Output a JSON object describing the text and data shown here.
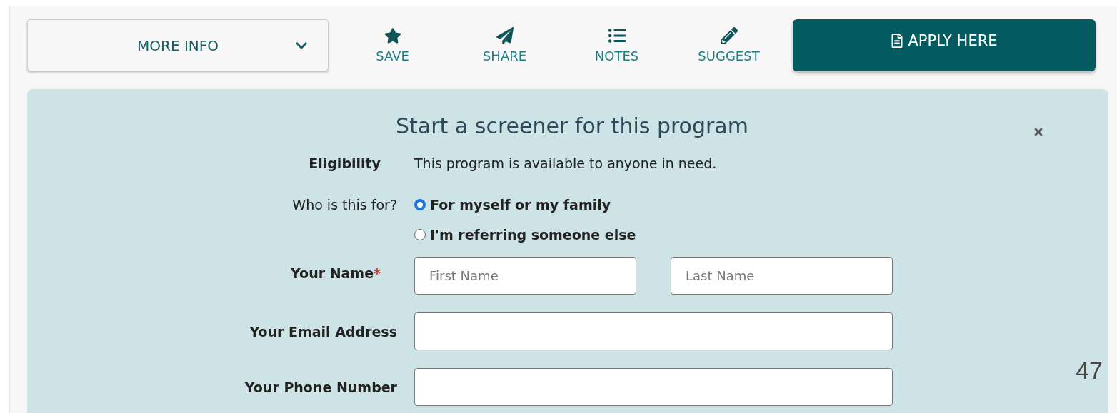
{
  "toolbar": {
    "more_info": {
      "label": "MORE INFO"
    },
    "actions": [
      {
        "kind": "save",
        "label": "SAVE"
      },
      {
        "kind": "share",
        "label": "SHARE"
      },
      {
        "kind": "notes",
        "label": "NOTES"
      },
      {
        "kind": "suggest",
        "label": "SUGGEST"
      }
    ],
    "apply": {
      "label": "APPLY HERE"
    }
  },
  "screener": {
    "title": "Start a screener for this program",
    "rows": [
      {
        "kind": "info",
        "label": "Eligibility",
        "text": "This program is available to anyone in need."
      },
      {
        "kind": "radio",
        "label": "Who is this for?",
        "options": [
          {
            "label": "For myself or my family",
            "selected": true
          },
          {
            "label": "I'm referring someone else",
            "selected": false
          }
        ]
      },
      {
        "kind": "name",
        "label": "Your Name",
        "required": true,
        "required_mark": "*",
        "fields": [
          {
            "placeholder": "First Name"
          },
          {
            "placeholder": "Last Name"
          }
        ]
      },
      {
        "kind": "text",
        "label": "Your Email Address"
      },
      {
        "kind": "text",
        "label": "Your Phone Number"
      }
    ]
  },
  "page_number": "47"
}
